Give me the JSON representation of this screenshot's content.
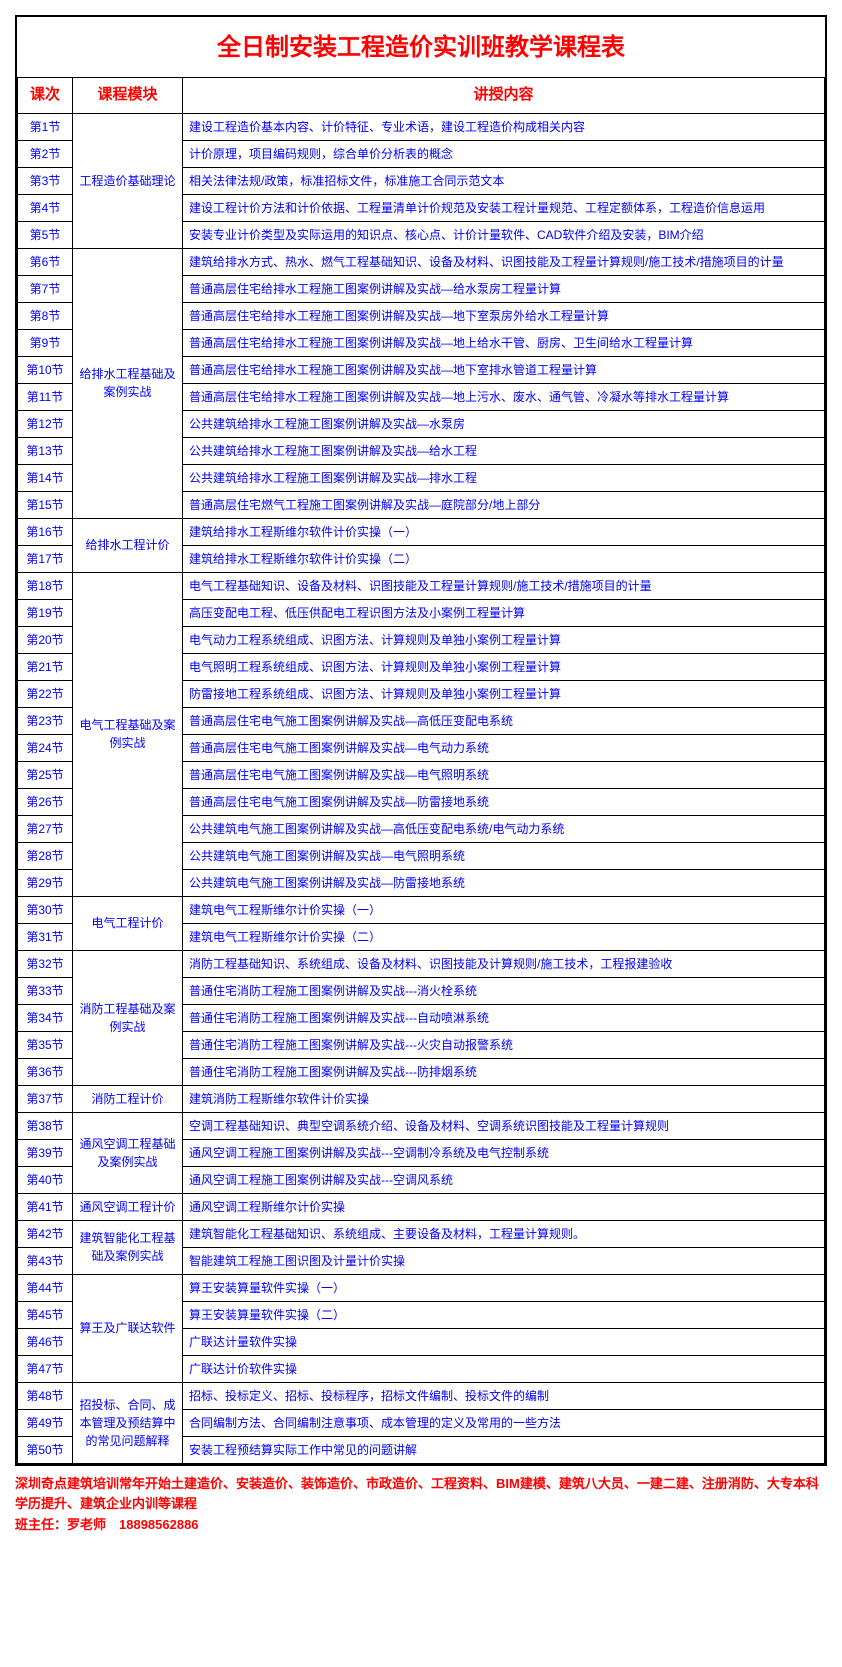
{
  "title": "全日制安装工程造价实训班教学课程表",
  "headers": {
    "session": "课次",
    "module": "课程模块",
    "content": "讲授内容"
  },
  "modules": [
    {
      "name": "工程造价基础理论",
      "rows": [
        {
          "s": "第1节",
          "c": "建设工程造价基本内容、计价特征、专业术语，建设工程造价构成相关内容"
        },
        {
          "s": "第2节",
          "c": "计价原理，项目编码规则，综合单价分析表的概念"
        },
        {
          "s": "第3节",
          "c": "相关法律法规/政策，标准招标文件，标准施工合同示范文本"
        },
        {
          "s": "第4节",
          "c": "建设工程计价方法和计价依据、工程量清单计价规范及安装工程计量规范、工程定额体系，工程造价信息运用"
        },
        {
          "s": "第5节",
          "c": "安装专业计价类型及实际运用的知识点、核心点、计价计量软件、CAD软件介绍及安装，BIM介绍"
        }
      ]
    },
    {
      "name": "给排水工程基础及案例实战",
      "rows": [
        {
          "s": "第6节",
          "c": "建筑给排水方式、热水、燃气工程基础知识、设备及材料、识图技能及工程量计算规则/施工技术/措施项目的计量"
        },
        {
          "s": "第7节",
          "c": "普通高层住宅给排水工程施工图案例讲解及实战—给水泵房工程量计算"
        },
        {
          "s": "第8节",
          "c": "普通高层住宅给排水工程施工图案例讲解及实战—地下室泵房外给水工程量计算"
        },
        {
          "s": "第9节",
          "c": "普通高层住宅给排水工程施工图案例讲解及实战—地上给水干管、厨房、卫生间给水工程量计算"
        },
        {
          "s": "第10节",
          "c": "普通高层住宅给排水工程施工图案例讲解及实战—地下室排水管道工程量计算"
        },
        {
          "s": "第11节",
          "c": "普通高层住宅给排水工程施工图案例讲解及实战—地上污水、废水、通气管、冷凝水等排水工程量计算"
        },
        {
          "s": "第12节",
          "c": "公共建筑给排水工程施工图案例讲解及实战—水泵房"
        },
        {
          "s": "第13节",
          "c": "公共建筑给排水工程施工图案例讲解及实战—给水工程"
        },
        {
          "s": "第14节",
          "c": "公共建筑给排水工程施工图案例讲解及实战—排水工程"
        },
        {
          "s": "第15节",
          "c": "普通高层住宅燃气工程施工图案例讲解及实战—庭院部分/地上部分"
        }
      ]
    },
    {
      "name": "给排水工程计价",
      "rows": [
        {
          "s": "第16节",
          "c": "建筑给排水工程斯维尔软件计价实操（一）"
        },
        {
          "s": "第17节",
          "c": "建筑给排水工程斯维尔软件计价实操（二）"
        }
      ]
    },
    {
      "name": "电气工程基础及案例实战",
      "rows": [
        {
          "s": "第18节",
          "c": "电气工程基础知识、设备及材料、识图技能及工程量计算规则/施工技术/措施项目的计量"
        },
        {
          "s": "第19节",
          "c": "高压变配电工程、低压供配电工程识图方法及小案例工程量计算"
        },
        {
          "s": "第20节",
          "c": "电气动力工程系统组成、识图方法、计算规则及单独小案例工程量计算"
        },
        {
          "s": "第21节",
          "c": "电气照明工程系统组成、识图方法、计算规则及单独小案例工程量计算"
        },
        {
          "s": "第22节",
          "c": "防雷接地工程系统组成、识图方法、计算规则及单独小案例工程量计算"
        },
        {
          "s": "第23节",
          "c": "普通高层住宅电气施工图案例讲解及实战—高低压变配电系统"
        },
        {
          "s": "第24节",
          "c": "普通高层住宅电气施工图案例讲解及实战—电气动力系统"
        },
        {
          "s": "第25节",
          "c": "普通高层住宅电气施工图案例讲解及实战—电气照明系统"
        },
        {
          "s": "第26节",
          "c": "普通高层住宅电气施工图案例讲解及实战—防雷接地系统"
        },
        {
          "s": "第27节",
          "c": "公共建筑电气施工图案例讲解及实战—高低压变配电系统/电气动力系统"
        },
        {
          "s": "第28节",
          "c": "公共建筑电气施工图案例讲解及实战—电气照明系统"
        },
        {
          "s": "第29节",
          "c": "公共建筑电气施工图案例讲解及实战—防雷接地系统"
        }
      ]
    },
    {
      "name": "电气工程计价",
      "rows": [
        {
          "s": "第30节",
          "c": "建筑电气工程斯维尔计价实操（一）"
        },
        {
          "s": "第31节",
          "c": "建筑电气工程斯维尔计价实操（二）"
        }
      ]
    },
    {
      "name": "消防工程基础及案例实战",
      "rows": [
        {
          "s": "第32节",
          "c": "消防工程基础知识、系统组成、设备及材料、识图技能及计算规则/施工技术，工程报建验收"
        },
        {
          "s": "第33节",
          "c": "普通住宅消防工程施工图案例讲解及实战---消火栓系统"
        },
        {
          "s": "第34节",
          "c": "普通住宅消防工程施工图案例讲解及实战---自动喷淋系统"
        },
        {
          "s": "第35节",
          "c": "普通住宅消防工程施工图案例讲解及实战---火灾自动报警系统"
        },
        {
          "s": "第36节",
          "c": "普通住宅消防工程施工图案例讲解及实战---防排烟系统"
        }
      ]
    },
    {
      "name": "消防工程计价",
      "rows": [
        {
          "s": "第37节",
          "c": "建筑消防工程斯维尔软件计价实操"
        }
      ]
    },
    {
      "name": "通风空调工程基础及案例实战",
      "rows": [
        {
          "s": "第38节",
          "c": "空调工程基础知识、典型空调系统介绍、设备及材料、空调系统识图技能及工程量计算规则"
        },
        {
          "s": "第39节",
          "c": "通风空调工程施工图案例讲解及实战---空调制冷系统及电气控制系统"
        },
        {
          "s": "第40节",
          "c": "通风空调工程施工图案例讲解及实战---空调风系统"
        }
      ]
    },
    {
      "name": "通风空调工程计价",
      "rows": [
        {
          "s": "第41节",
          "c": "通风空调工程斯维尔计价实操"
        }
      ]
    },
    {
      "name": "建筑智能化工程基础及案例实战",
      "rows": [
        {
          "s": "第42节",
          "c": "建筑智能化工程基础知识、系统组成、主要设备及材料，工程量计算规则。"
        },
        {
          "s": "第43节",
          "c": "智能建筑工程施工图识图及计量计价实操"
        }
      ]
    },
    {
      "name": "算王及广联达软件",
      "rows": [
        {
          "s": "第44节",
          "c": "算王安装算量软件实操（一）"
        },
        {
          "s": "第45节",
          "c": "算王安装算量软件实操（二）"
        },
        {
          "s": "第46节",
          "c": "广联达计量软件实操"
        },
        {
          "s": "第47节",
          "c": "广联达计价软件实操"
        }
      ]
    },
    {
      "name": "招投标、合同、成本管理及预结算中的常见问题解释",
      "rows": [
        {
          "s": "第48节",
          "c": "招标、投标定义、招标、投标程序，招标文件编制、投标文件的编制"
        },
        {
          "s": "第49节",
          "c": "合同编制方法、合同编制注意事项、成本管理的定义及常用的一些方法"
        },
        {
          "s": "第50节",
          "c": "安装工程预结算实际工作中常见的问题讲解"
        }
      ]
    }
  ],
  "footer": {
    "line1": "深圳奇点建筑培训常年开始土建造价、安装造价、装饰造价、市政造价、工程资料、BIM建模、建筑八大员、一建二建、注册消防、大专本科学历提升、建筑企业内训等课程",
    "line2": "班主任：罗老师　18898562886"
  }
}
